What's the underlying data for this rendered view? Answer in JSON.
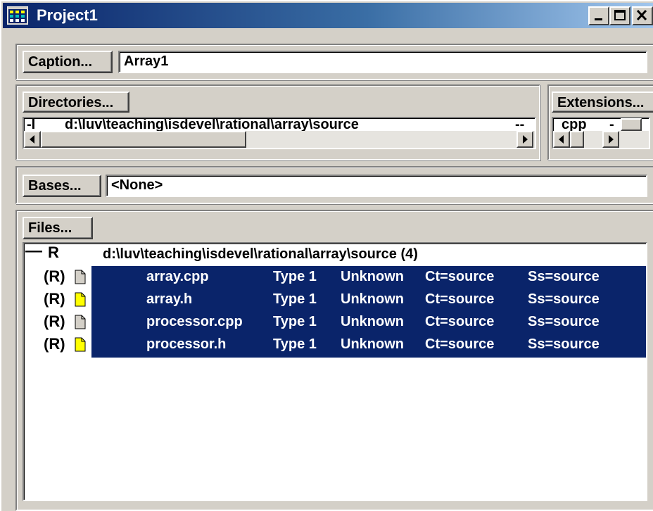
{
  "window": {
    "title": "Project1",
    "title_icon": "project-grid-icon"
  },
  "caption": {
    "button_label": "Caption...",
    "value": "Array1"
  },
  "directories": {
    "button_label": "Directories...",
    "row_flag": "-I",
    "row_path": "d:\\luv\\teaching\\isdevel\\rational\\array\\source",
    "row_tail": "--"
  },
  "extensions": {
    "button_label": "Extensions...",
    "value": "cpp",
    "tail": "-"
  },
  "bases": {
    "button_label": "Bases...",
    "value": "<None>"
  },
  "files": {
    "button_label": "Files...",
    "root": {
      "toggle": "—",
      "mark": "R",
      "label": "d:\\luv\\teaching\\isdevel\\rational\\array\\source (4)"
    },
    "rows": [
      {
        "mark": "(R)",
        "name": "array.cpp",
        "type": "Type 1",
        "status": "Unknown",
        "ct": "Ct=source",
        "ss": "Ss=source",
        "icon": "cpp-file-icon"
      },
      {
        "mark": "(R)",
        "name": "array.h",
        "type": "Type 1",
        "status": "Unknown",
        "ct": "Ct=source",
        "ss": "Ss=source",
        "icon": "header-file-icon"
      },
      {
        "mark": "(R)",
        "name": "processor.cpp",
        "type": "Type 1",
        "status": "Unknown",
        "ct": "Ct=source",
        "ss": "Ss=source",
        "icon": "cpp-file-icon"
      },
      {
        "mark": "(R)",
        "name": "processor.h",
        "type": "Type 1",
        "status": "Unknown",
        "ct": "Ct=source",
        "ss": "Ss=source",
        "icon": "header-file-icon"
      }
    ]
  },
  "colors": {
    "selection": "#0a246a",
    "title_start": "#0a246a",
    "title_end": "#a6caf0",
    "face": "#d4d0c8",
    "header_file": "#ffff00"
  }
}
